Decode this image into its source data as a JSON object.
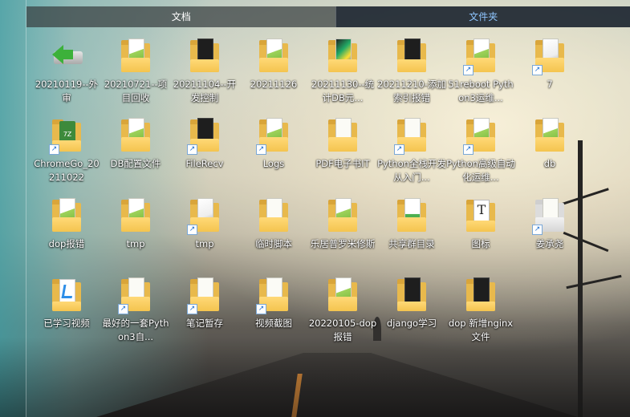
{
  "tabs": {
    "documents": "文档",
    "folders": "文件夹"
  },
  "colors": {
    "active_tab_text": "#8fc6ff",
    "folder": "#f4c44f"
  },
  "items": [
    {
      "label": "20210119--外审",
      "icon": "usb-drive-green-arrow-icon"
    },
    {
      "label": "20210721--项目回收",
      "icon": "folder-icon"
    },
    {
      "label": "20211104--开发控制",
      "icon": "folder-dark-doc-icon"
    },
    {
      "label": "20211126",
      "icon": "folder-icon"
    },
    {
      "label": "20211130--统计DB元...",
      "icon": "folder-colorful-icon"
    },
    {
      "label": "20211210-添加索引报错",
      "icon": "folder-dark-doc-icon"
    },
    {
      "label": "51reboot Python3运维...",
      "icon": "folder-shortcut-icon"
    },
    {
      "label": "7",
      "icon": "folder-shortcut-icon"
    },
    {
      "label": "ChromeGo_20211022",
      "icon": "folder-chrome-shortcut-icon"
    },
    {
      "label": "DB配置文件",
      "icon": "folder-icon"
    },
    {
      "label": "FileRecv",
      "icon": "folder-shortcut-icon"
    },
    {
      "label": "Logs",
      "icon": "folder-shortcut-icon"
    },
    {
      "label": "PDF电子书IT",
      "icon": "folder-icon"
    },
    {
      "label": "Python全栈开发从入门...",
      "icon": "folder-shortcut-icon"
    },
    {
      "label": "Python高级自动化运维...",
      "icon": "folder-shortcut-icon"
    },
    {
      "label": "db",
      "icon": "folder-icon"
    },
    {
      "label": "dop报错",
      "icon": "folder-icon"
    },
    {
      "label": "tmp",
      "icon": "folder-icon"
    },
    {
      "label": "tmp",
      "icon": "folder-shortcut-icon"
    },
    {
      "label": "临时脚本",
      "icon": "folder-icon"
    },
    {
      "label": "乐居普罗米修斯",
      "icon": "folder-icon"
    },
    {
      "label": "共享群目录",
      "icon": "folder-icon"
    },
    {
      "label": "图标",
      "icon": "folder-t-icon"
    },
    {
      "label": "姜承尧",
      "icon": "folder-shortcut-icon"
    },
    {
      "label": "已学习视频",
      "icon": "folder-vscode-icon"
    },
    {
      "label": "最好的一套Python3自...",
      "icon": "folder-shortcut-icon"
    },
    {
      "label": "笔记暂存",
      "icon": "folder-shortcut-icon"
    },
    {
      "label": "视频截图",
      "icon": "folder-shortcut-icon"
    },
    {
      "label": "20220105-dop报错",
      "icon": "folder-icon"
    },
    {
      "label": "django学习",
      "icon": "folder-dark-doc-icon"
    },
    {
      "label": "dop 新增nginx文件",
      "icon": "folder-dark-doc-icon"
    }
  ]
}
